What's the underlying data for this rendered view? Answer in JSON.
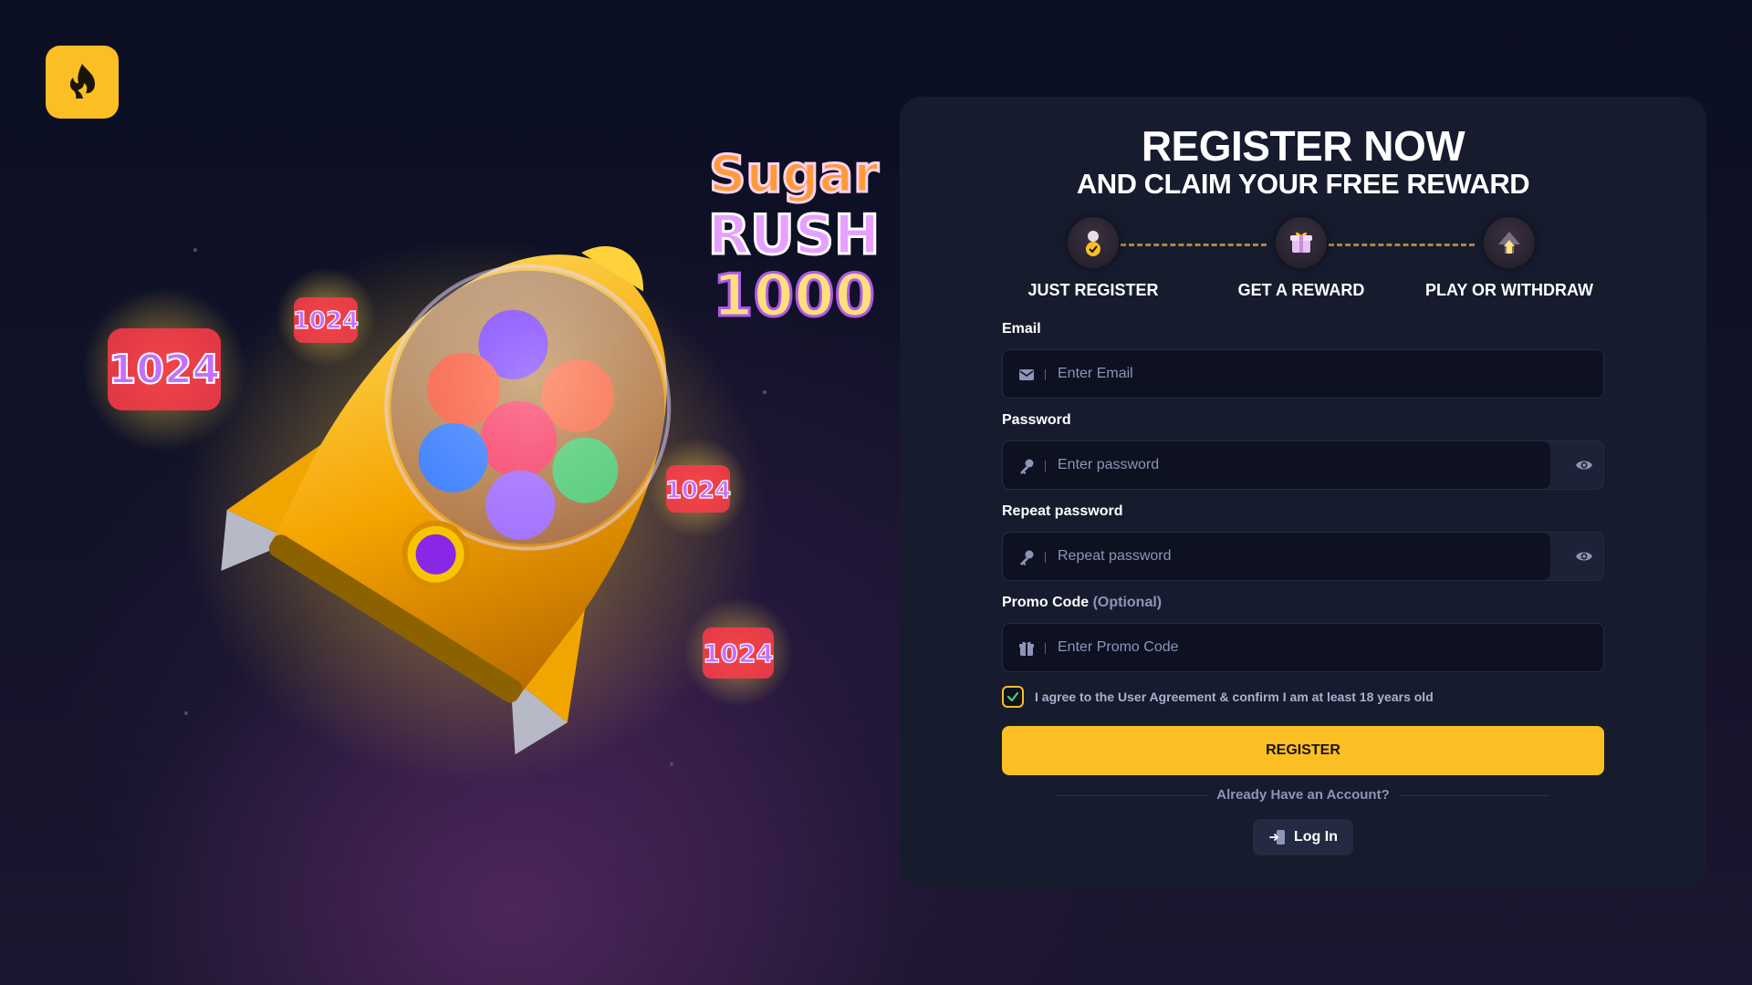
{
  "brand": {
    "logo_icon": "spade-flame-icon",
    "accent": "#fbbf24"
  },
  "hero": {
    "game_title_line1": "Sugar",
    "game_title_line2": "RUSH",
    "game_title_line3": "1000",
    "badge_text": "1024"
  },
  "register": {
    "title": "REGISTER NOW",
    "subtitle": "AND CLAIM YOUR FREE REWARD",
    "steps": [
      {
        "label": "JUST REGISTER",
        "icon": "user-check-icon"
      },
      {
        "label": "GET A REWARD",
        "icon": "gift-icon"
      },
      {
        "label": "PLAY OR WITHDRAW",
        "icon": "arrow-up-icon"
      }
    ],
    "email": {
      "label": "Email",
      "placeholder": "Enter Email",
      "value": ""
    },
    "password": {
      "label": "Password",
      "placeholder": "Enter password",
      "value": ""
    },
    "repeat_password": {
      "label": "Repeat password",
      "placeholder": "Repeat password",
      "value": ""
    },
    "promo": {
      "label": "Promo Code",
      "optional": "(Optional)",
      "placeholder": "Enter Promo Code",
      "value": ""
    },
    "agreement": {
      "text": "I agree to the User Agreement & confirm I am at least 18 years old",
      "checked": true
    },
    "submit_label": "REGISTER",
    "already_text": "Already Have an Account?",
    "login_label": "Log In"
  }
}
